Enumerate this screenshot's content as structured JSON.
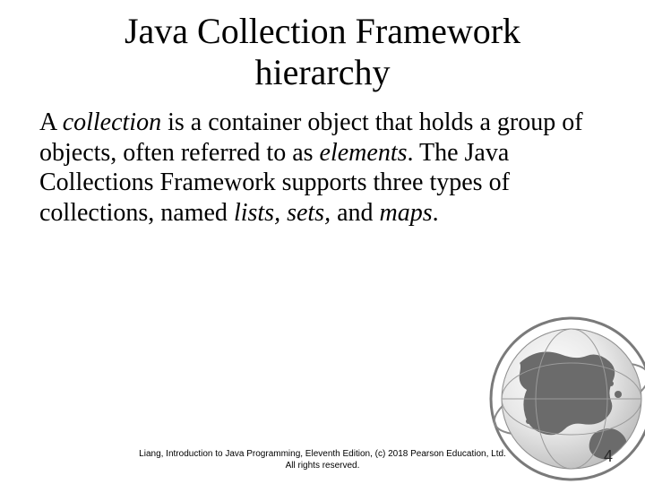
{
  "title_line1": "Java Collection Framework",
  "title_line2": "hierarchy",
  "body": {
    "t1": "A ",
    "collection": "collection",
    "t2": " is a container object that holds a group of objects, often referred to as ",
    "elements": "elements",
    "t3": ". The Java Collections Framework supports three types of collections, named ",
    "lists": "lists",
    "comma1": ", ",
    "sets": "sets",
    "comma2": ", ",
    "and": "and ",
    "maps": "maps",
    "period": "."
  },
  "footer_line1": "Liang, Introduction to Java Programming, Eleventh Edition, (c) 2018 Pearson Education, Ltd.",
  "footer_line2": "All rights reserved.",
  "page_number": "4"
}
